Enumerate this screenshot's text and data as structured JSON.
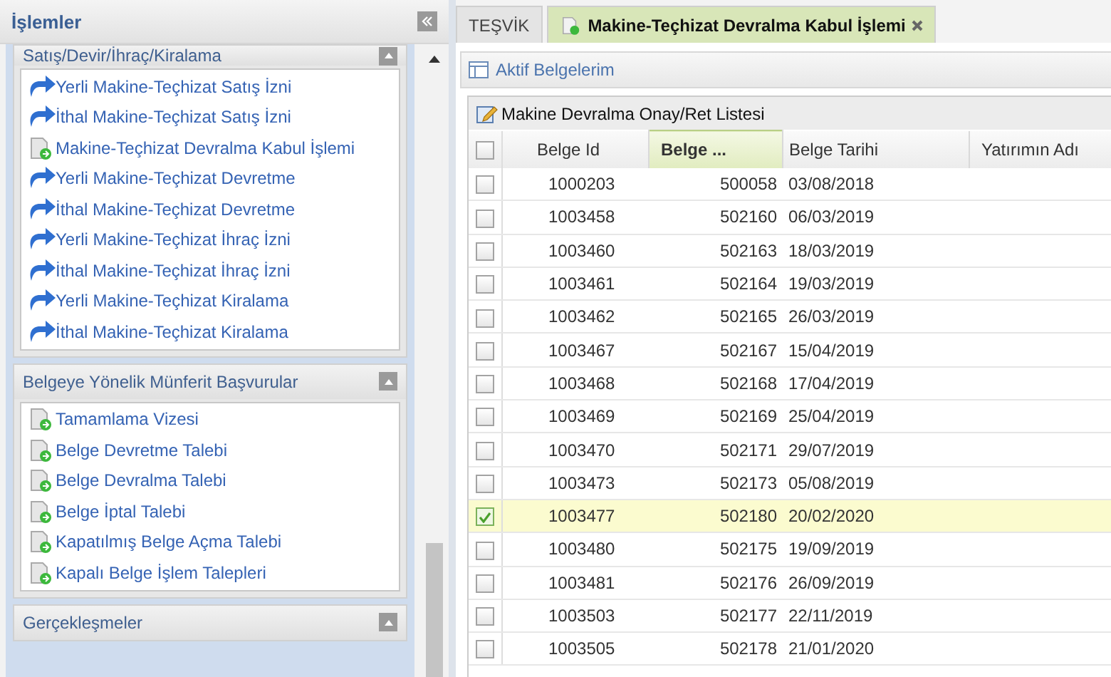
{
  "sidebar": {
    "title": "İşlemler",
    "sections": [
      {
        "title": "Satış/Devir/İhraç/Kiralama",
        "items": [
          {
            "label": "Yerli Makine-Teçhizat Satış İzni",
            "kind": "arrow"
          },
          {
            "label": "İthal Makine-Teçhizat Satış İzni",
            "kind": "arrow"
          },
          {
            "label": "Makine-Teçhizat Devralma Kabul İşlemi",
            "kind": "doc"
          },
          {
            "label": "Yerli Makine-Teçhizat Devretme",
            "kind": "arrow"
          },
          {
            "label": "İthal Makine-Teçhizat Devretme",
            "kind": "arrow"
          },
          {
            "label": "Yerli Makine-Teçhizat İhraç İzni",
            "kind": "arrow"
          },
          {
            "label": "İthal Makine-Teçhizat İhraç İzni",
            "kind": "arrow"
          },
          {
            "label": "Yerli Makine-Teçhizat Kiralama",
            "kind": "arrow"
          },
          {
            "label": "İthal Makine-Teçhizat Kiralama",
            "kind": "arrow"
          }
        ]
      },
      {
        "title": "Belgeye Yönelik Münferit Başvurular",
        "items": [
          {
            "label": "Tamamlama Vizesi",
            "kind": "doc"
          },
          {
            "label": "Belge Devretme Talebi",
            "kind": "doc"
          },
          {
            "label": "Belge Devralma Talebi",
            "kind": "doc"
          },
          {
            "label": "Belge İptal Talebi",
            "kind": "doc"
          },
          {
            "label": "Kapatılmış Belge Açma Talebi",
            "kind": "doc"
          },
          {
            "label": "Kapalı Belge İşlem Talepleri",
            "kind": "doc"
          }
        ]
      },
      {
        "title": "Gerçekleşmeler"
      }
    ]
  },
  "tabs": [
    {
      "label": "TEŞVİK",
      "selected": false,
      "closable": false
    },
    {
      "label": "Makine-Teçhizat Devralma Kabul İşlemi",
      "selected": true,
      "closable": true
    }
  ],
  "panel": {
    "title": "Aktif Belgelerim"
  },
  "grid": {
    "title": "Makine Devralma Onay/Ret Listesi",
    "all_checked": false,
    "columns": [
      {
        "label": "Belge Id",
        "sorted": false
      },
      {
        "label": "Belge ...",
        "sorted": true
      },
      {
        "label": "Belge Tarihi",
        "sorted": false
      },
      {
        "label": "Yatırımın Adı",
        "sorted": false
      }
    ],
    "rows": [
      {
        "cells": [
          "1000203",
          "500058",
          "03/08/2018"
        ],
        "selected": false
      },
      {
        "cells": [
          "1003458",
          "502160",
          "06/03/2019"
        ],
        "selected": false
      },
      {
        "cells": [
          "1003460",
          "502163",
          "18/03/2019"
        ],
        "selected": false
      },
      {
        "cells": [
          "1003461",
          "502164",
          "19/03/2019"
        ],
        "selected": false
      },
      {
        "cells": [
          "1003462",
          "502165",
          "26/03/2019"
        ],
        "selected": false
      },
      {
        "cells": [
          "1003467",
          "502167",
          "15/04/2019"
        ],
        "selected": false
      },
      {
        "cells": [
          "1003468",
          "502168",
          "17/04/2019"
        ],
        "selected": false
      },
      {
        "cells": [
          "1003469",
          "502169",
          "25/04/2019"
        ],
        "selected": false
      },
      {
        "cells": [
          "1003470",
          "502171",
          "29/07/2019"
        ],
        "selected": false
      },
      {
        "cells": [
          "1003473",
          "502173",
          "05/08/2019"
        ],
        "selected": false
      },
      {
        "cells": [
          "1003477",
          "502180",
          "20/02/2020"
        ],
        "selected": true
      },
      {
        "cells": [
          "1003480",
          "502175",
          "19/09/2019"
        ],
        "selected": false
      },
      {
        "cells": [
          "1003481",
          "502176",
          "26/09/2019"
        ],
        "selected": false
      },
      {
        "cells": [
          "1003503",
          "502177",
          "22/11/2019"
        ],
        "selected": false
      },
      {
        "cells": [
          "1003505",
          "502178",
          "21/01/2020"
        ],
        "selected": false
      }
    ]
  }
}
